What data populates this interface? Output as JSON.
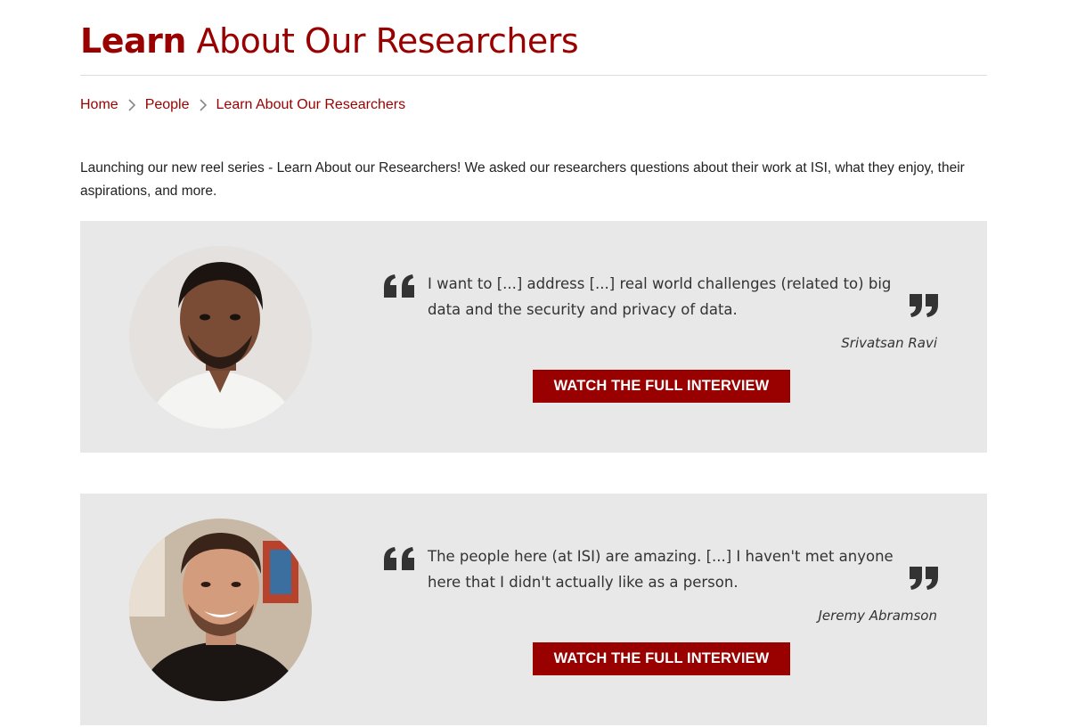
{
  "header": {
    "title_bold": "Learn",
    "title_rest": " About Our Researchers"
  },
  "breadcrumb": {
    "items": [
      "Home",
      "People",
      "Learn About Our Researchers"
    ]
  },
  "intro": "Launching our new reel series - Learn About our Researchers! We asked our researchers questions about their work at ISI, what they enjoy, their aspirations, and more.",
  "cards": [
    {
      "quote": "I want to [...] address [...] real world challenges (related to) big data and the security and privacy of data.",
      "author": "Srivatsan Ravi",
      "button_label": "WATCH THE FULL INTERVIEW"
    },
    {
      "quote": "The people here (at ISI) are amazing. [...] I haven't met anyone here that I didn't actually like as a person.",
      "author": "Jeremy Abramson",
      "button_label": "WATCH THE FULL INTERVIEW"
    }
  ],
  "colors": {
    "accent": "#990000",
    "card_bg": "#e8e8e8",
    "quote_mark": "#333333"
  },
  "icons": {
    "breadcrumb_separator": "chevron-right-icon",
    "quote_open": "quote-open-icon",
    "quote_close": "quote-close-icon"
  }
}
